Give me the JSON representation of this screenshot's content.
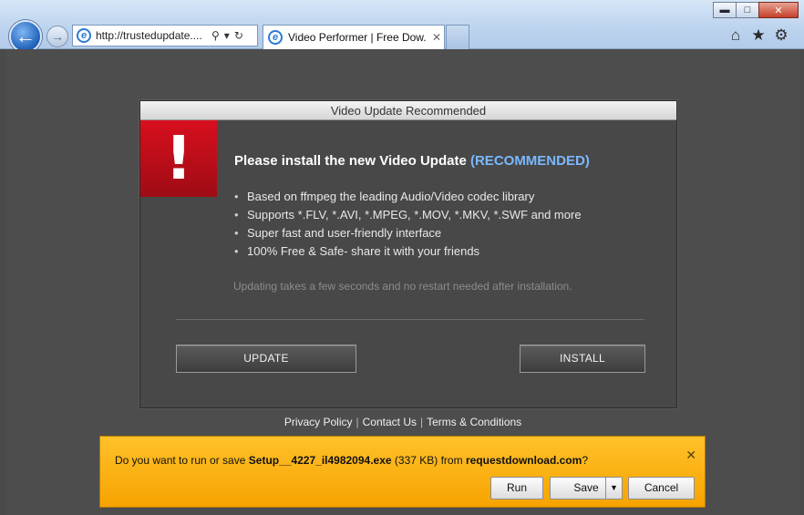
{
  "window": {
    "minimize": "▬",
    "maximize": "□",
    "close": "✕"
  },
  "nav": {
    "back": "←",
    "forward": "→",
    "address": "http://trustedupdate....",
    "search_icon": "⚲",
    "dropdown_icon": "▾",
    "refresh_icon": "↻"
  },
  "tab": {
    "title": "Video Performer | Free Dow...",
    "close": "✕"
  },
  "toolbar": {
    "home_icon": "⌂",
    "favorites_icon": "★",
    "tools_icon": "⚙"
  },
  "dialog": {
    "title": "Video Update Recommended",
    "alert_glyph": "!",
    "headline": "Please install the new Video Update",
    "headline_tag": "(RECOMMENDED)",
    "features": [
      "Based on ffmpeg the leading Audio/Video codec library",
      "Supports *.FLV, *.AVI, *.MPEG, *.MOV, *.MKV, *.SWF and more",
      "Super fast and user-friendly interface",
      "100% Free & Safe- share it with your friends"
    ],
    "note": "Updating takes a few seconds and no restart needed after installation.",
    "update_label": "UPDATE",
    "install_label": "INSTALL"
  },
  "footer": {
    "privacy": "Privacy Policy",
    "contact": "Contact Us",
    "terms": "Terms & Conditions",
    "separator": "|"
  },
  "download": {
    "prefix": "Do you want to run or save",
    "filename": "Setup__4227_il4982094.exe",
    "size": "(337 KB) from",
    "source": "requestdownload.com",
    "suffix": "?",
    "close": "✕",
    "run_label": "Run",
    "save_label": "Save",
    "save_menu_icon": "▼",
    "cancel_label": "Cancel"
  },
  "colors": {
    "alert_red": "#c50e19",
    "recommended_blue": "#7ab8ff",
    "download_bar": "#ffb516",
    "page_background": "#4d4d4d"
  }
}
